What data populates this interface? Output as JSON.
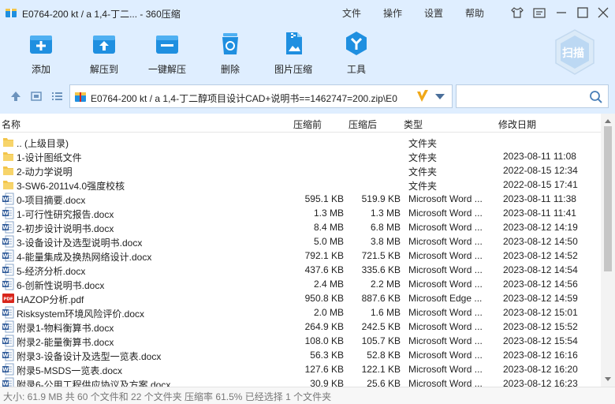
{
  "window": {
    "title": "E0764-200 kt / a 1,4-丁二... - 360压缩",
    "menu": [
      "文件",
      "操作",
      "设置",
      "帮助"
    ]
  },
  "toolbar": {
    "tools": [
      {
        "label": "添加",
        "icon": "add-box-icon"
      },
      {
        "label": "解压到",
        "icon": "extract-box-icon"
      },
      {
        "label": "一键解压",
        "icon": "one-click-extract-icon"
      },
      {
        "label": "删除",
        "icon": "recycle-bin-icon"
      },
      {
        "label": "图片压缩",
        "icon": "image-compress-icon"
      },
      {
        "label": "工具",
        "icon": "tools-hexagon-icon"
      }
    ],
    "scan_label": "扫描"
  },
  "address": {
    "path": "E0764-200 kt / a 1,4-丁二醇项目设计CAD+说明书==1462747=200.zip\\E0"
  },
  "search": {
    "placeholder": ""
  },
  "columns": {
    "name": "名称",
    "size_before": "压缩前",
    "size_after": "压缩后",
    "type": "类型",
    "modified": "修改日期"
  },
  "files": [
    {
      "icon": "folder",
      "name": ".. (上级目录)",
      "size_before": "",
      "size_after": "",
      "type": "文件夹",
      "modified": ""
    },
    {
      "icon": "folder",
      "name": "1-设计图纸文件",
      "size_before": "",
      "size_after": "",
      "type": "文件夹",
      "modified": "2023-08-11 11:08"
    },
    {
      "icon": "folder",
      "name": "2-动力学说明",
      "size_before": "",
      "size_after": "",
      "type": "文件夹",
      "modified": "2022-08-15 12:34"
    },
    {
      "icon": "folder",
      "name": "3-SW6-2011v4.0强度校核",
      "size_before": "",
      "size_after": "",
      "type": "文件夹",
      "modified": "2022-08-15 17:41"
    },
    {
      "icon": "word",
      "name": "0-项目摘要.docx",
      "size_before": "595.1 KB",
      "size_after": "519.9 KB",
      "type": "Microsoft Word ...",
      "modified": "2023-08-11 11:38"
    },
    {
      "icon": "word",
      "name": "1-可行性研究报告.docx",
      "size_before": "1.3 MB",
      "size_after": "1.3 MB",
      "type": "Microsoft Word ...",
      "modified": "2023-08-11 11:41"
    },
    {
      "icon": "word",
      "name": "2-初步设计说明书.docx",
      "size_before": "8.4 MB",
      "size_after": "6.8 MB",
      "type": "Microsoft Word ...",
      "modified": "2023-08-12 14:19"
    },
    {
      "icon": "word",
      "name": "3-设备设计及选型说明书.docx",
      "size_before": "5.0 MB",
      "size_after": "3.8 MB",
      "type": "Microsoft Word ...",
      "modified": "2023-08-12 14:50"
    },
    {
      "icon": "word",
      "name": "4-能量集成及换热网络设计.docx",
      "size_before": "792.1 KB",
      "size_after": "721.5 KB",
      "type": "Microsoft Word ...",
      "modified": "2023-08-12 14:52"
    },
    {
      "icon": "word",
      "name": "5-经济分析.docx",
      "size_before": "437.6 KB",
      "size_after": "335.6 KB",
      "type": "Microsoft Word ...",
      "modified": "2023-08-12 14:54"
    },
    {
      "icon": "word",
      "name": "6-创新性说明书.docx",
      "size_before": "2.4 MB",
      "size_after": "2.2 MB",
      "type": "Microsoft Word ...",
      "modified": "2023-08-12 14:56"
    },
    {
      "icon": "pdf",
      "name": "HAZOP分析.pdf",
      "size_before": "950.8 KB",
      "size_after": "887.6 KB",
      "type": "Microsoft Edge ...",
      "modified": "2023-08-12 14:59"
    },
    {
      "icon": "word",
      "name": "Risksystem环境风险评价.docx",
      "size_before": "2.0 MB",
      "size_after": "1.6 MB",
      "type": "Microsoft Word ...",
      "modified": "2023-08-12 15:01"
    },
    {
      "icon": "word",
      "name": "附录1-物料衡算书.docx",
      "size_before": "264.9 KB",
      "size_after": "242.5 KB",
      "type": "Microsoft Word ...",
      "modified": "2023-08-12 15:52"
    },
    {
      "icon": "word",
      "name": "附录2-能量衡算书.docx",
      "size_before": "108.0 KB",
      "size_after": "105.7 KB",
      "type": "Microsoft Word ...",
      "modified": "2023-08-12 15:54"
    },
    {
      "icon": "word",
      "name": "附录3-设备设计及选型一览表.docx",
      "size_before": "56.3 KB",
      "size_after": "52.8 KB",
      "type": "Microsoft Word ...",
      "modified": "2023-08-12 16:16"
    },
    {
      "icon": "word",
      "name": "附录5-MSDS一览表.docx",
      "size_before": "127.6 KB",
      "size_after": "122.1 KB",
      "type": "Microsoft Word ...",
      "modified": "2023-08-12 16:20"
    },
    {
      "icon": "word",
      "name": "附录6-公用工程供应协议及方案.docx",
      "size_before": "30.9 KB",
      "size_after": "25.6 KB",
      "type": "Microsoft Word ...",
      "modified": "2023-08-12 16:23"
    }
  ],
  "scroll": {
    "position_fraction": 0.0,
    "visible_fraction": 0.55
  },
  "status": "大小: 61.9 MB 共 60 个文件和 22 个文件夹 压缩率 61.5% 已经选择 1 个文件夹",
  "colors": {
    "accent": "#1f8fe0",
    "chrome_bg": "#dfeeff",
    "folder": "#f3c54a",
    "word": "#2b5797",
    "pdf": "#d8261c"
  }
}
